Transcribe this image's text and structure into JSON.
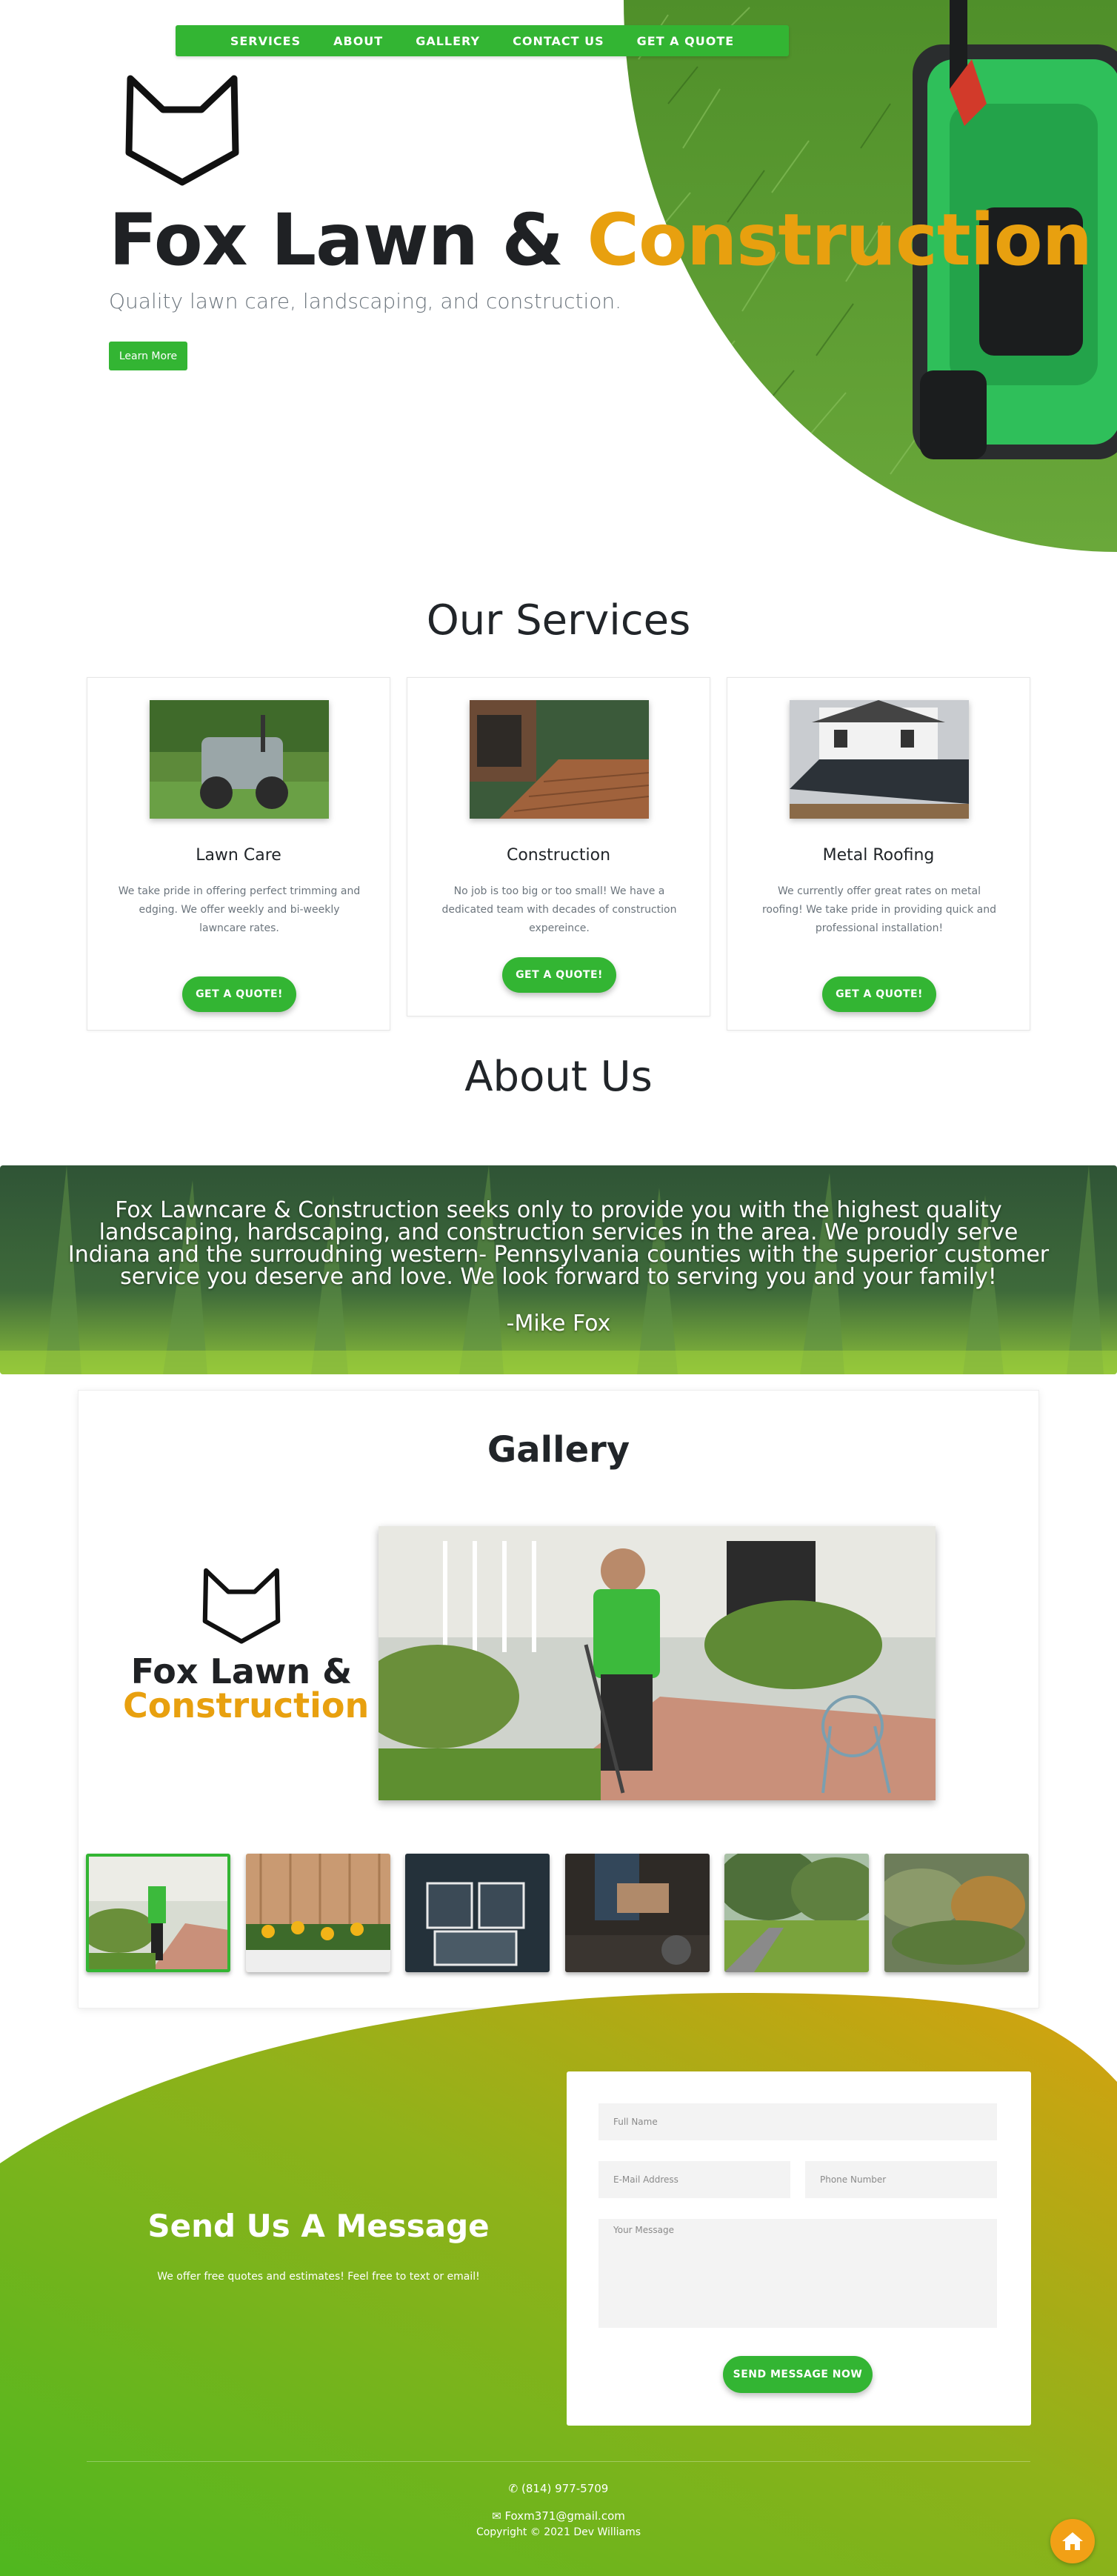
{
  "nav": {
    "items": [
      "SERVICES",
      "ABOUT",
      "GALLERY",
      "CONTACT US",
      "GET A QUOTE"
    ]
  },
  "hero": {
    "title_main": "Fox Lawn & ",
    "title_accent": "Construction",
    "subtitle": "Quality lawn care, landscaping, and construction.",
    "button": "Learn More",
    "logo_icon": "fox-head-outline"
  },
  "services": {
    "title": "Our Services",
    "cards": [
      {
        "name": "Lawn Care",
        "text": "We take pride in offering perfect trimming and edging. We offer weekly and bi-weekly lawncare rates.",
        "button": "GET A QUOTE!"
      },
      {
        "name": "Construction",
        "text": "No job is too big or too small! We have a dedicated team with decades of construction expereince.",
        "button": "GET A QUOTE!"
      },
      {
        "name": "Metal Roofing",
        "text": "We currently offer great rates on metal roofing! We take pride in providing quick and professional installation!",
        "button": "GET A QUOTE!"
      }
    ]
  },
  "about": {
    "title": "About Us",
    "text": "Fox Lawncare & Construction seeks only to provide you with the highest quality landscaping, hardscaping, and construction services in the area. We proudly serve Indiana and the surroudning western- Pennsylvania counties with the superior customer service you deserve and love. We look forward to serving you and your family!",
    "signature": "-Mike Fox"
  },
  "gallery": {
    "title": "Gallery",
    "logo_line1": "Fox Lawn &",
    "logo_line2": "Construction",
    "thumbnails": [
      "lawn-edging",
      "flower-bed",
      "roof-stone",
      "hardscape-work",
      "yard-trees",
      "garden-shrubs"
    ]
  },
  "contact": {
    "title": "Send Us A Message",
    "subtitle": "We offer free quotes and estimates! Feel free to text or email!",
    "form": {
      "name_placeholder": "Full Name",
      "email_placeholder": "E-Mail Address",
      "phone_placeholder": "Phone Number",
      "message_placeholder": "Your Message",
      "submit": "SEND MESSAGE NOW"
    }
  },
  "footer": {
    "phone": "(814) 977-5709",
    "email": "Foxm371@gmail.com",
    "copyright": "Copyright © 2021 Dev Williams",
    "home_icon": "home-icon"
  },
  "colors": {
    "primary_green": "#33b533",
    "accent_orange": "#e8a00f",
    "dark_text": "#1f2124"
  }
}
